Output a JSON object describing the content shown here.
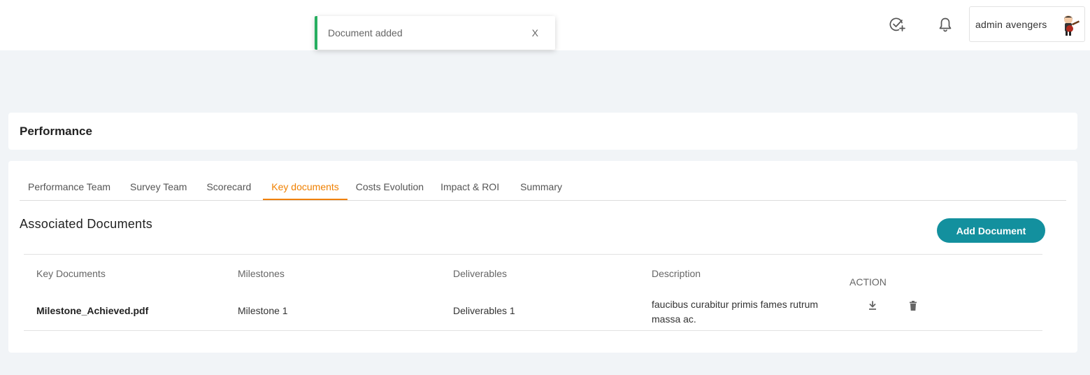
{
  "toast": {
    "message": "Document added",
    "close_label": "X",
    "accent": "#27ae60"
  },
  "header": {
    "icons": [
      "check-plus-icon",
      "bell-icon"
    ],
    "user_name": "admin avengers"
  },
  "page": {
    "title": "Performance"
  },
  "tabs": [
    {
      "label": "Performance Team",
      "active": false
    },
    {
      "label": "Survey Team",
      "active": false
    },
    {
      "label": "Scorecard",
      "active": false
    },
    {
      "label": "Key documents",
      "active": true
    },
    {
      "label": "Costs Evolution",
      "active": false
    },
    {
      "label": "Impact & ROI",
      "active": false
    },
    {
      "label": "Summary",
      "active": false
    }
  ],
  "section": {
    "title": "Associated Documents",
    "add_button": "Add Document",
    "button_color": "#13909e"
  },
  "table": {
    "columns": [
      "Key Documents",
      "Milestones",
      "Deliverables",
      "Description",
      "ACTION"
    ],
    "rows": [
      {
        "key_document": "Milestone_Achieved.pdf",
        "milestone": "Milestone 1",
        "deliverable": "Deliverables 1",
        "description": "faucibus curabitur primis fames rutrum massa ac.",
        "actions": [
          "download-icon",
          "trash-icon"
        ]
      }
    ]
  },
  "colors": {
    "tab_active": "#f08000",
    "background": "#f1f4f7"
  }
}
